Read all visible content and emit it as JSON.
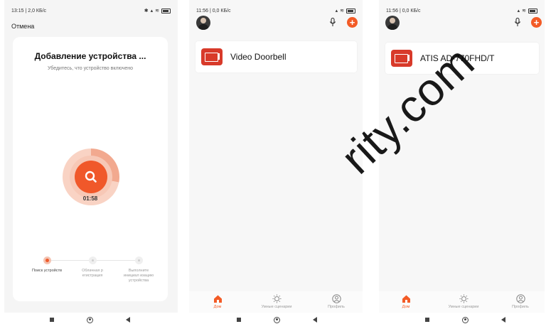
{
  "screen1": {
    "status_time": "13:15 | 2,0 КБ/с",
    "cancel_label": "Отмена",
    "title": "Добавление устройства ...",
    "subtitle": "Убедитесь, что устройство включено",
    "timer": "01:58",
    "steps": [
      {
        "label": "Поиск устройств",
        "state": "active"
      },
      {
        "label": "Облачная р егистрация",
        "state": "idle"
      },
      {
        "label": "Выполните инициал изацию устройства",
        "state": "idle"
      }
    ]
  },
  "screen2": {
    "status_time": "11:56 | 0,0 КБ/с",
    "device_name": "Video Doorbell"
  },
  "screen3": {
    "status_time": "11:56 | 0,0 КБ/с",
    "device_name": "ATIS AD-770FHD/T"
  },
  "tabbar": {
    "home_label": "Дом",
    "scenes_label": "Умные сценарии",
    "profile_label": "Профиль"
  },
  "watermark": "rity.com",
  "colors": {
    "accent": "#f35b26",
    "device_icon": "#d83a2a"
  }
}
